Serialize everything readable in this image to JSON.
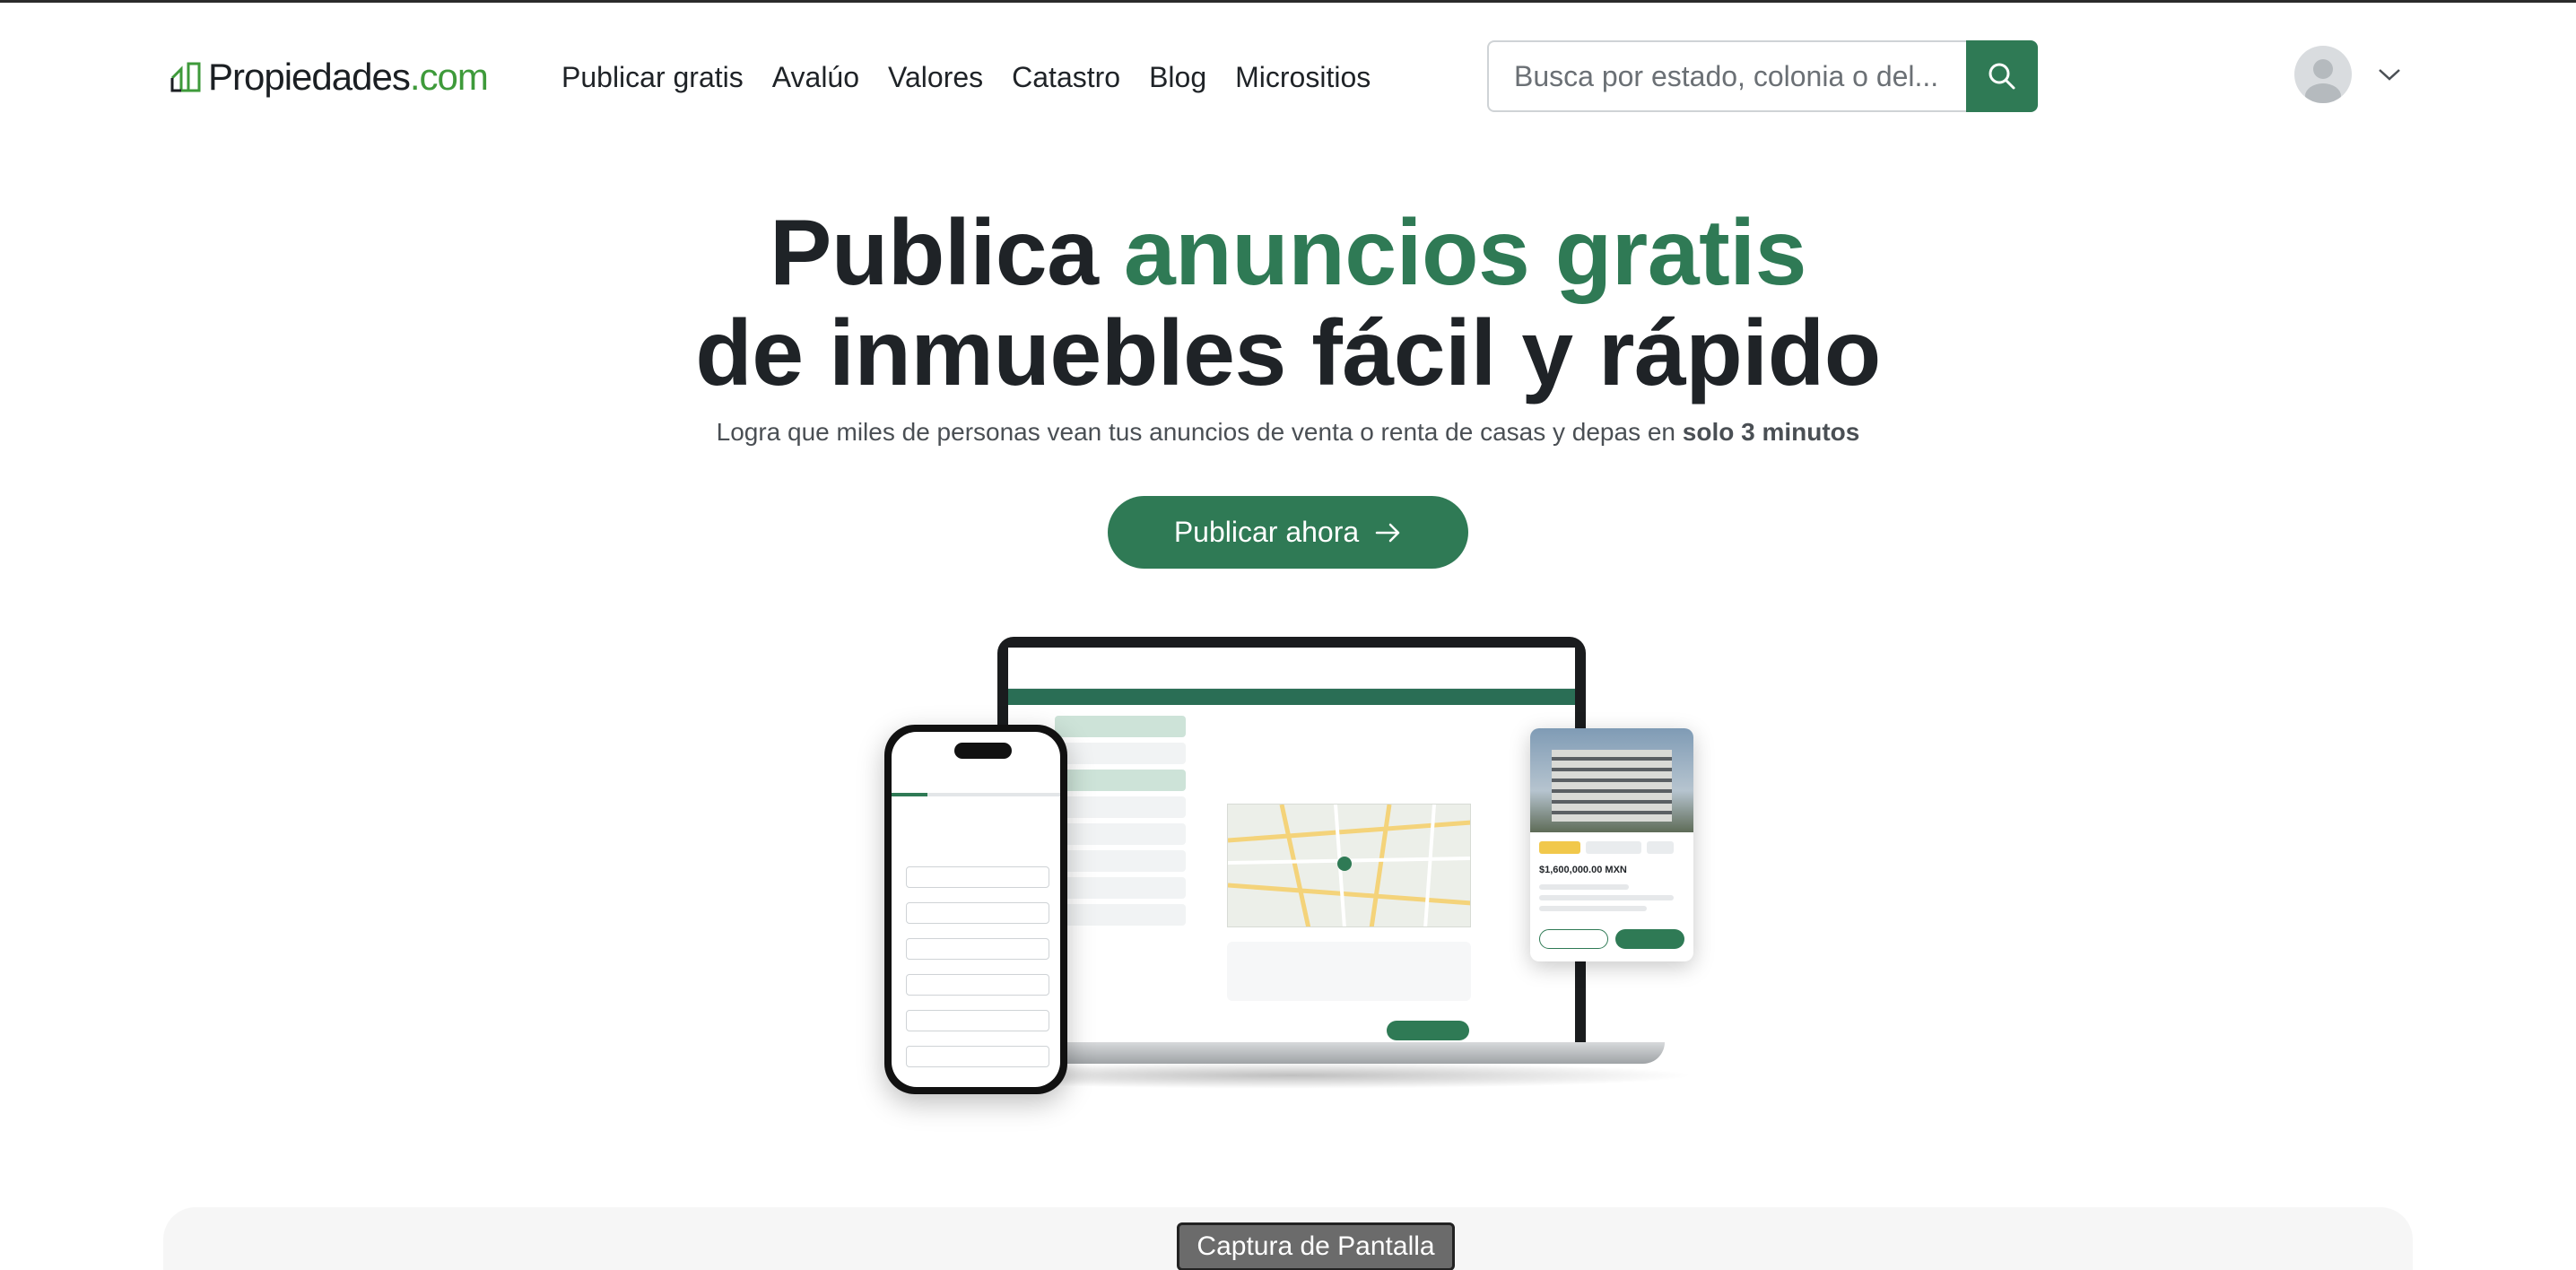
{
  "logo": {
    "name": "Propiedades",
    "suffix": ".com"
  },
  "nav": [
    {
      "label": "Publicar gratis"
    },
    {
      "label": "Avalúo"
    },
    {
      "label": "Valores"
    },
    {
      "label": "Catastro"
    },
    {
      "label": "Blog"
    },
    {
      "label": "Micrositios"
    }
  ],
  "search": {
    "placeholder": "Busca por estado, colonia o del..."
  },
  "hero": {
    "title_line1_plain": "Publica ",
    "title_line1_accent": "anuncios gratis",
    "title_line2": "de inmuebles fácil y rápido",
    "subtitle": "Logra que miles de personas vean tus anuncios de venta o renta de casas y depas en ",
    "subtitle_bold": "solo 3 minutos",
    "cta_label": "Publicar ahora"
  },
  "preview_card": {
    "price": "$1,600,000.00 MXN"
  },
  "capture_button": "Captura de Pantalla",
  "colors": {
    "brand_green": "#2f7a55",
    "logo_green": "#3e9a3a",
    "text_dark": "#1f2327"
  },
  "icons": [
    "house-logo-icon",
    "search-icon",
    "user-avatar-icon",
    "chevron-down-icon",
    "arrow-right-icon"
  ]
}
